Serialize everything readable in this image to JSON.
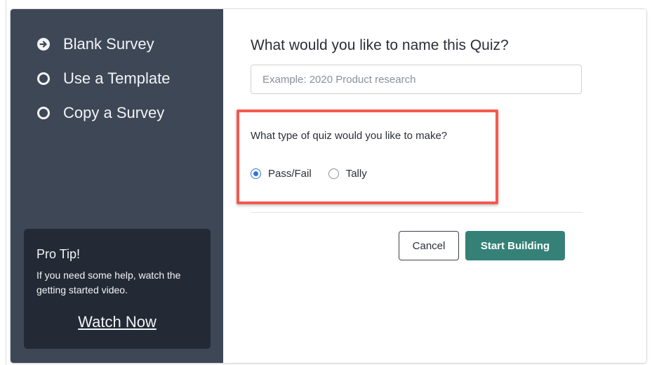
{
  "sidebar": {
    "items": [
      {
        "label": "Blank Survey",
        "icon": "arrow-circle-right-icon",
        "selected": true
      },
      {
        "label": "Use a Template",
        "icon": "radio-circle-icon",
        "selected": false
      },
      {
        "label": "Copy a Survey",
        "icon": "radio-circle-icon",
        "selected": false
      }
    ],
    "tip": {
      "title": "Pro Tip!",
      "body": "If you need some help, watch the getting started video.",
      "link": "Watch Now"
    }
  },
  "main": {
    "title": "What would you like to name this Quiz?",
    "name_input": {
      "value": "",
      "placeholder": "Example: 2020 Product research"
    },
    "quiz_type": {
      "label": "What type of quiz would you like to make?",
      "options": [
        {
          "label": "Pass/Fail",
          "checked": true
        },
        {
          "label": "Tally",
          "checked": false
        }
      ]
    },
    "buttons": {
      "cancel": "Cancel",
      "start": "Start Building"
    }
  },
  "colors": {
    "sidebar_bg": "#3e4756",
    "tip_bg": "#242a35",
    "accent": "#358177",
    "highlight": "#f45a4d",
    "radio": "#3276d1"
  }
}
